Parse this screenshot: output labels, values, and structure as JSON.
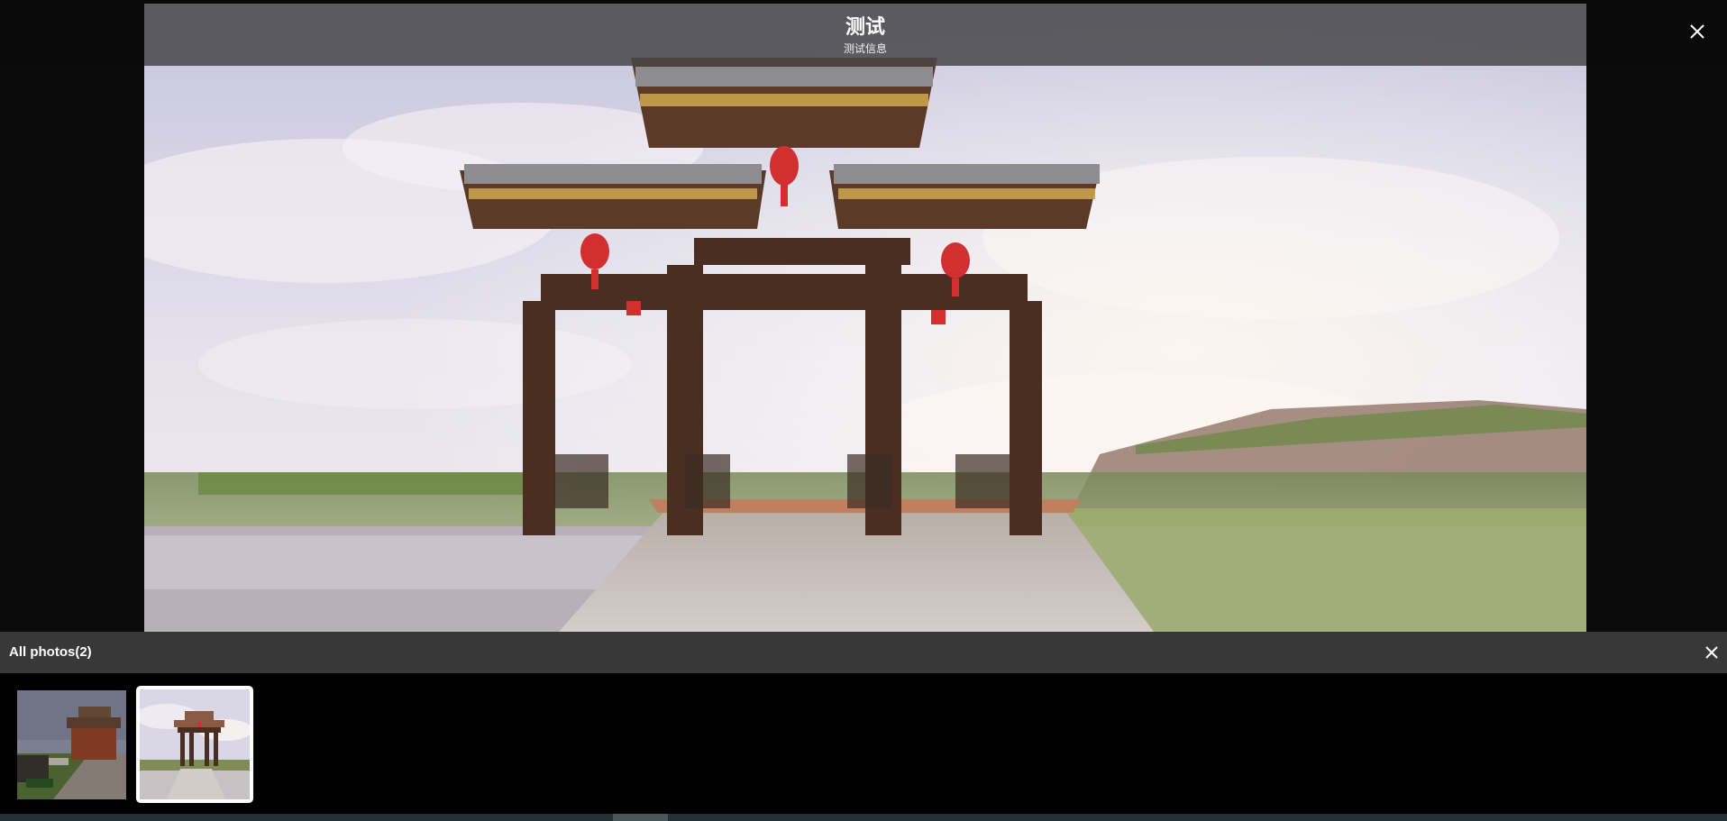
{
  "viewer": {
    "caption_title": "测试",
    "caption_subtitle": "测试信息",
    "close_icon": "close-icon"
  },
  "gallery": {
    "title": "All photos(2)",
    "close_icon": "close-icon",
    "thumbnails": [
      {
        "name": "thumbnail-1",
        "selected": false
      },
      {
        "name": "thumbnail-2",
        "selected": true
      }
    ]
  },
  "colors": {
    "caption_bar": "#46464a",
    "gallery_header": "#383838",
    "background": "#0b0b0b",
    "selected_border": "#ffffff"
  }
}
